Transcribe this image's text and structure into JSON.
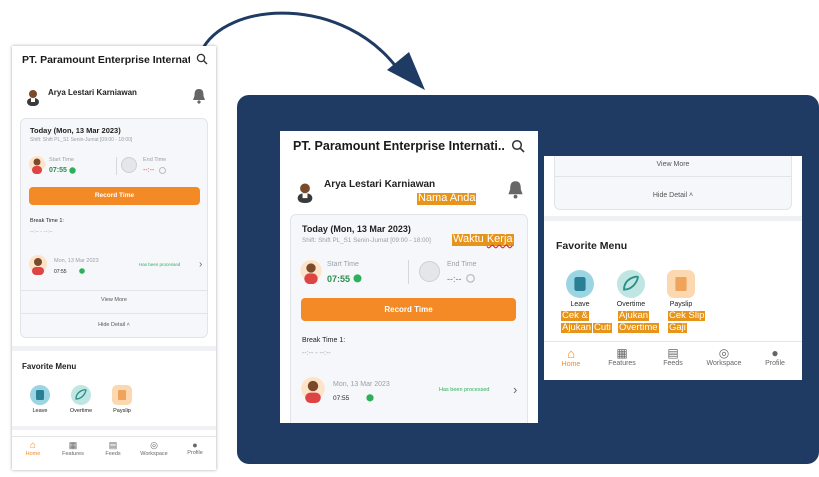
{
  "colors": {
    "accent": "#f48a26",
    "panel": "#1f3a63",
    "highlight": "#e7941a",
    "green": "#2eaf5a"
  },
  "app": {
    "company": "PT. Paramount Enterprise Internati...",
    "user_name": "Arya Lestari Karniawan",
    "date_title": "Today (Mon, 13 Mar 2023)",
    "shift": "Shift: Shift PL_S1 Senin-Jumat [09:00 - 18:00]",
    "start_time_label": "Start Time",
    "start_time_value": "07:55",
    "end_time_label": "End Time",
    "end_time_value": "--:--",
    "record_button": "Record Time",
    "break_label": "Break Time 1:",
    "break_value": "--:-- - --:--",
    "history_date": "Mon, 13 Mar 2023",
    "history_time": "07:55",
    "history_status": "Has been processed",
    "view_more": "View More",
    "hide_detail": "Hide Detail",
    "favorite_title": "Favorite Menu",
    "favorites": [
      "Leave",
      "Overtime",
      "Payslip"
    ],
    "nav": [
      "Home",
      "Features",
      "Feeds",
      "Workspace",
      "Profile"
    ]
  },
  "annotations": {
    "name": "Nama Anda",
    "shift_a": "Waktu ",
    "shift_b": "Kerja",
    "leave_1": "Cek &",
    "leave_2": "Ajukan",
    "leave_3": "Cuti",
    "ot_1": "Ajukan",
    "ot_2": "Overtime",
    "pay_1": "Cek Slip",
    "pay_2": "Gaji"
  }
}
